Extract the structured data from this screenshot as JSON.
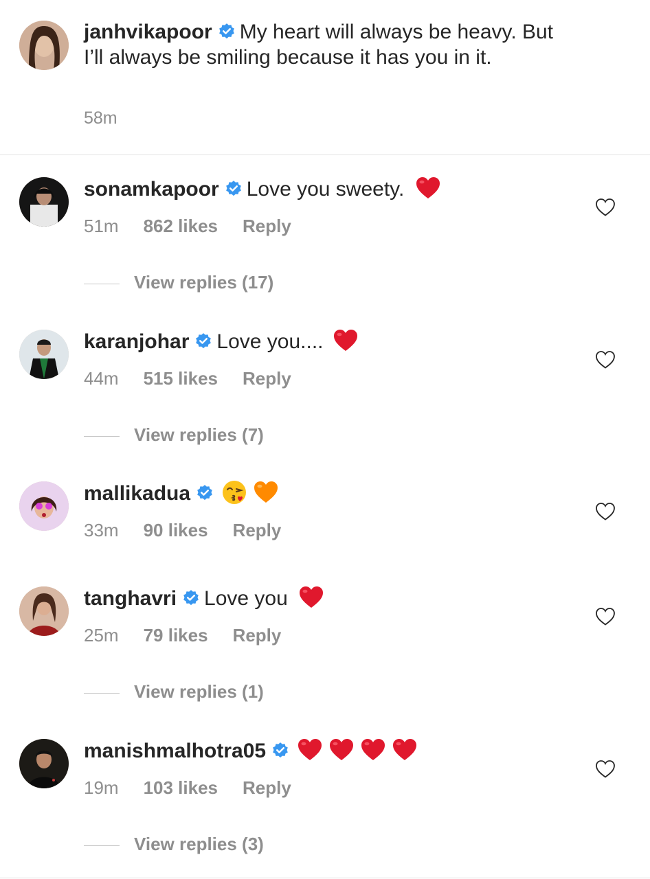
{
  "caption": {
    "username": "janhvikapoor",
    "text": "My heart will always be heavy. But I’ll always be smiling because it has you in it.",
    "time": "58m"
  },
  "comments": [
    {
      "username": "sonamkapoor",
      "text": "Love you sweety.",
      "emojis": [
        "red-heart"
      ],
      "time": "51m",
      "likes": "862 likes",
      "reply": "Reply",
      "view_replies": "View replies (17)"
    },
    {
      "username": "karanjohar",
      "text": "Love you....",
      "emojis": [
        "red-heart"
      ],
      "time": "44m",
      "likes": "515 likes",
      "reply": "Reply",
      "view_replies": "View replies (7)"
    },
    {
      "username": "mallikadua",
      "text": "",
      "emojis": [
        "kissing-face",
        "orange-heart"
      ],
      "time": "33m",
      "likes": "90 likes",
      "reply": "Reply",
      "view_replies": ""
    },
    {
      "username": "tanghavri",
      "text": "Love you",
      "emojis": [
        "red-heart"
      ],
      "time": "25m",
      "likes": "79 likes",
      "reply": "Reply",
      "view_replies": "View replies (1)"
    },
    {
      "username": "manishmalhotra05",
      "text": "",
      "emojis": [
        "red-heart",
        "red-heart",
        "red-heart",
        "red-heart"
      ],
      "time": "19m",
      "likes": "103 likes",
      "reply": "Reply",
      "view_replies": "View replies (3)"
    }
  ],
  "colors": {
    "verified": "#3897f0",
    "muted": "#8e8e8e",
    "text": "#262626",
    "red_heart": "#e0182d",
    "orange_heart": "#ff8a00"
  }
}
